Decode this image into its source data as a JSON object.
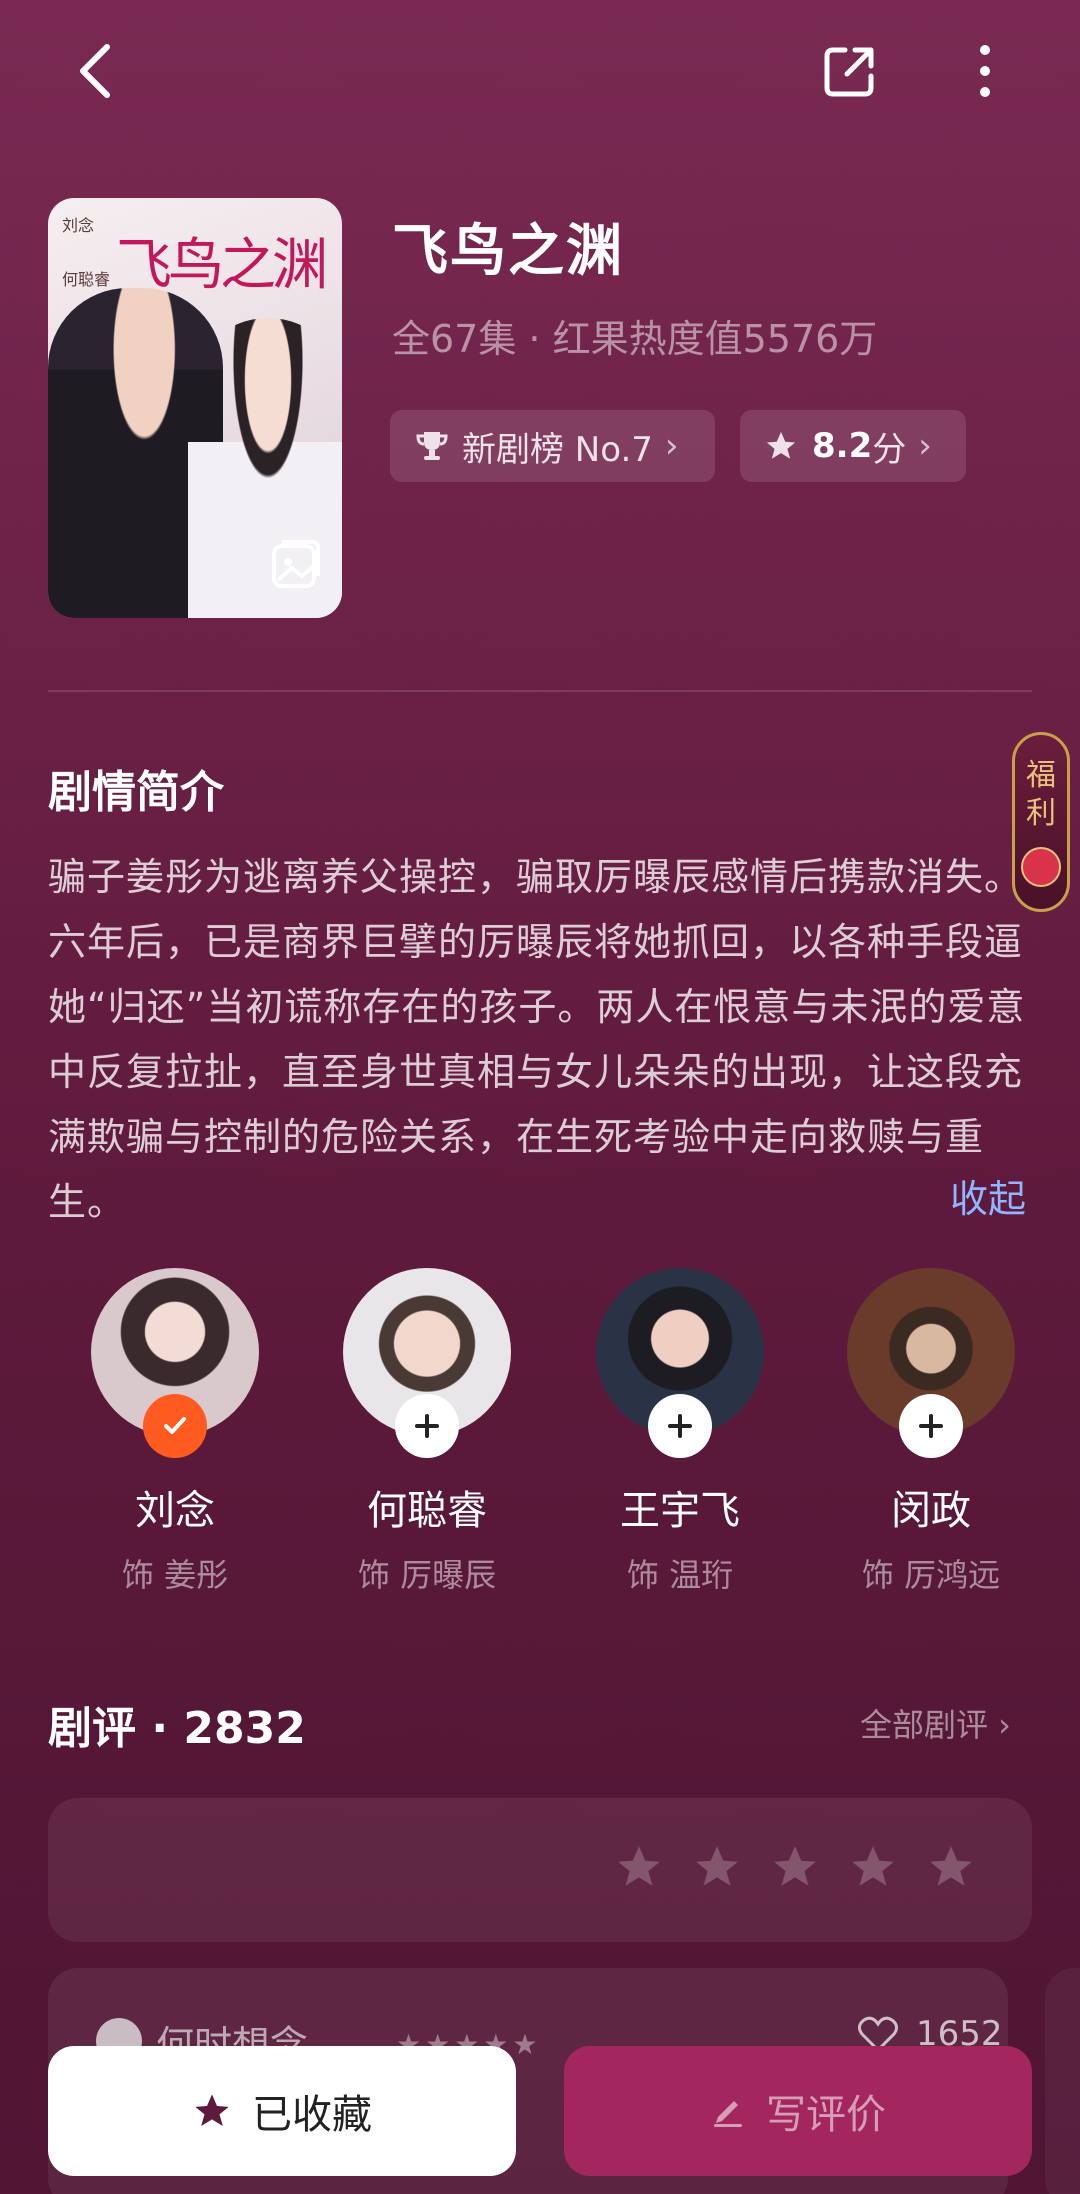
{
  "show": {
    "title": "飞鸟之渊",
    "meta": "全67集 · 红果热度值5576万",
    "rank_label": "新剧榜 No.7",
    "score_value": "8.2",
    "score_unit": "分",
    "poster_title": "飞鸟之渊",
    "poster_credits": [
      "刘念",
      "何聪睿"
    ]
  },
  "synopsis": {
    "title": "剧情简介",
    "text": "骗子姜彤为逃离养父操控，骗取厉曝辰感情后携款消失。六年后，已是商界巨擘的厉曝辰将她抓回，以各种手段逼她“归还”当初谎称存在的孩子。两人在恨意与未泯的爱意中反复拉扯，直至身世真相与女儿朵朵的出现，让这段充满欺骗与控制的危险关系，在生死考验中走向救赎与重生。",
    "collapse": "收起"
  },
  "welfare": {
    "label_1": "福",
    "label_2": "利"
  },
  "cast": [
    {
      "name": "刘念",
      "role": "饰 姜彤",
      "followed": true
    },
    {
      "name": "何聪睿",
      "role": "饰 厉曝辰",
      "followed": false
    },
    {
      "name": "王宇飞",
      "role": "饰 温珩",
      "followed": false
    },
    {
      "name": "闵政",
      "role": "饰 厉鸿远",
      "followed": false
    }
  ],
  "reviews": {
    "title": "剧评 · 2832",
    "all_link": "全部剧评 ›",
    "first_user": "何时想念",
    "first_likes": "1652"
  },
  "actions": {
    "favorite": "已收藏",
    "write_review": "写评价"
  },
  "colors": {
    "accent": "#a3275e",
    "followed_badge": "#ff5a1f",
    "link": "#8fb6ff"
  }
}
